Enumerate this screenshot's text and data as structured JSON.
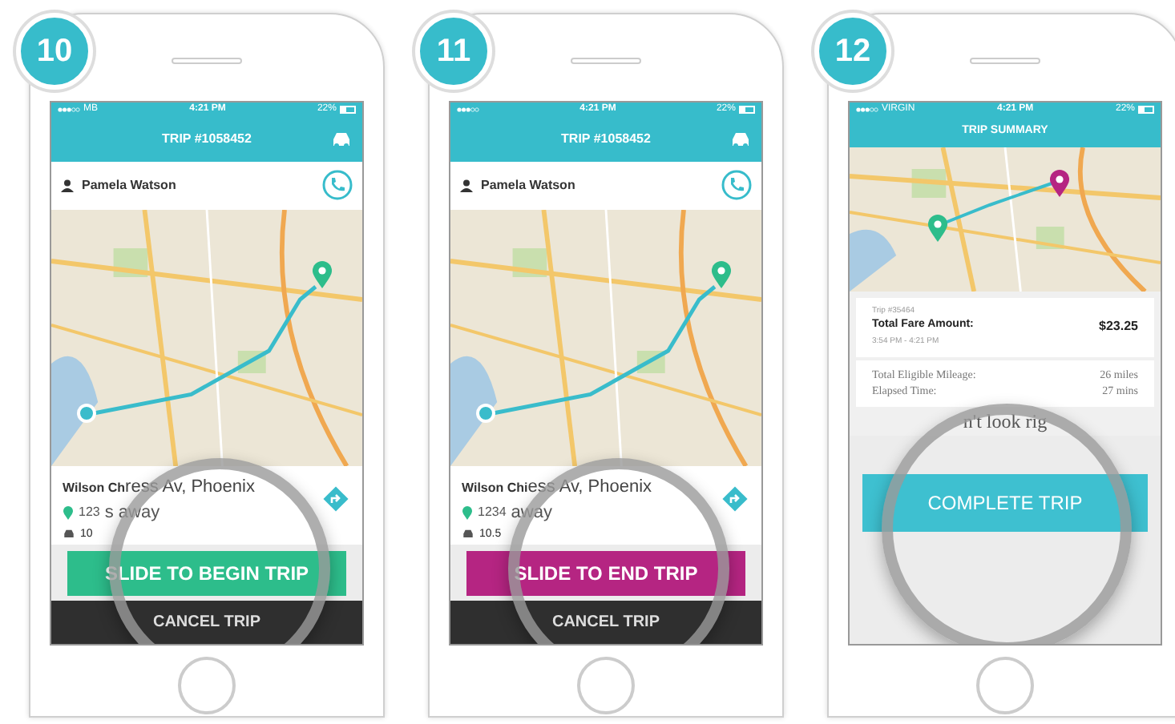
{
  "phones": [
    {
      "kind": "trip",
      "step": "10",
      "status_bar": {
        "carrier": "MB",
        "time": "4:21 PM",
        "battery": "22%"
      },
      "title": "TRIP #1058452",
      "rider": "Pamela Watson",
      "address_small": "Wilson Ch",
      "address_large": "ress Av, Phoenix",
      "distance_small": "123",
      "distance_large": "s away",
      "eta": "10",
      "slide_button": {
        "label": "SLIDE TO BEGIN TRIP",
        "color": "#2dbd8b"
      },
      "cancel_button": "CANCEL TRIP"
    },
    {
      "kind": "trip",
      "step": "11",
      "status_bar": {
        "time": "4:21 PM",
        "battery": "22%"
      },
      "title": "TRIP #1058452",
      "rider": "Pamela Watson",
      "address_small": "Wilson Chi",
      "address_large": "ess Av, Phoenix",
      "distance_small": "1234",
      "distance_large": "away",
      "eta": "10.5",
      "slide_button": {
        "label": "SLIDE TO END TRIP",
        "color": "#b52582"
      },
      "cancel_button": "CANCEL TRIP"
    },
    {
      "kind": "summary",
      "step": "12",
      "status_bar": {
        "carrier": "VIRGIN",
        "time": "4:21 PM",
        "battery": "22%"
      },
      "title": "TRIP SUMMARY",
      "trip_id": "Trip #35464",
      "fare_label": "Total Fare Amount:",
      "fare": "$23.25",
      "time_range": "3:54 PM - 4:21 PM",
      "details": [
        {
          "label": "Total Eligible Mileage:",
          "value": "26 miles"
        },
        {
          "label": "Elapsed Time:",
          "value": "27 mins"
        }
      ],
      "feedback": "n't look rig",
      "complete_button": "COMPLETE TRIP"
    }
  ]
}
